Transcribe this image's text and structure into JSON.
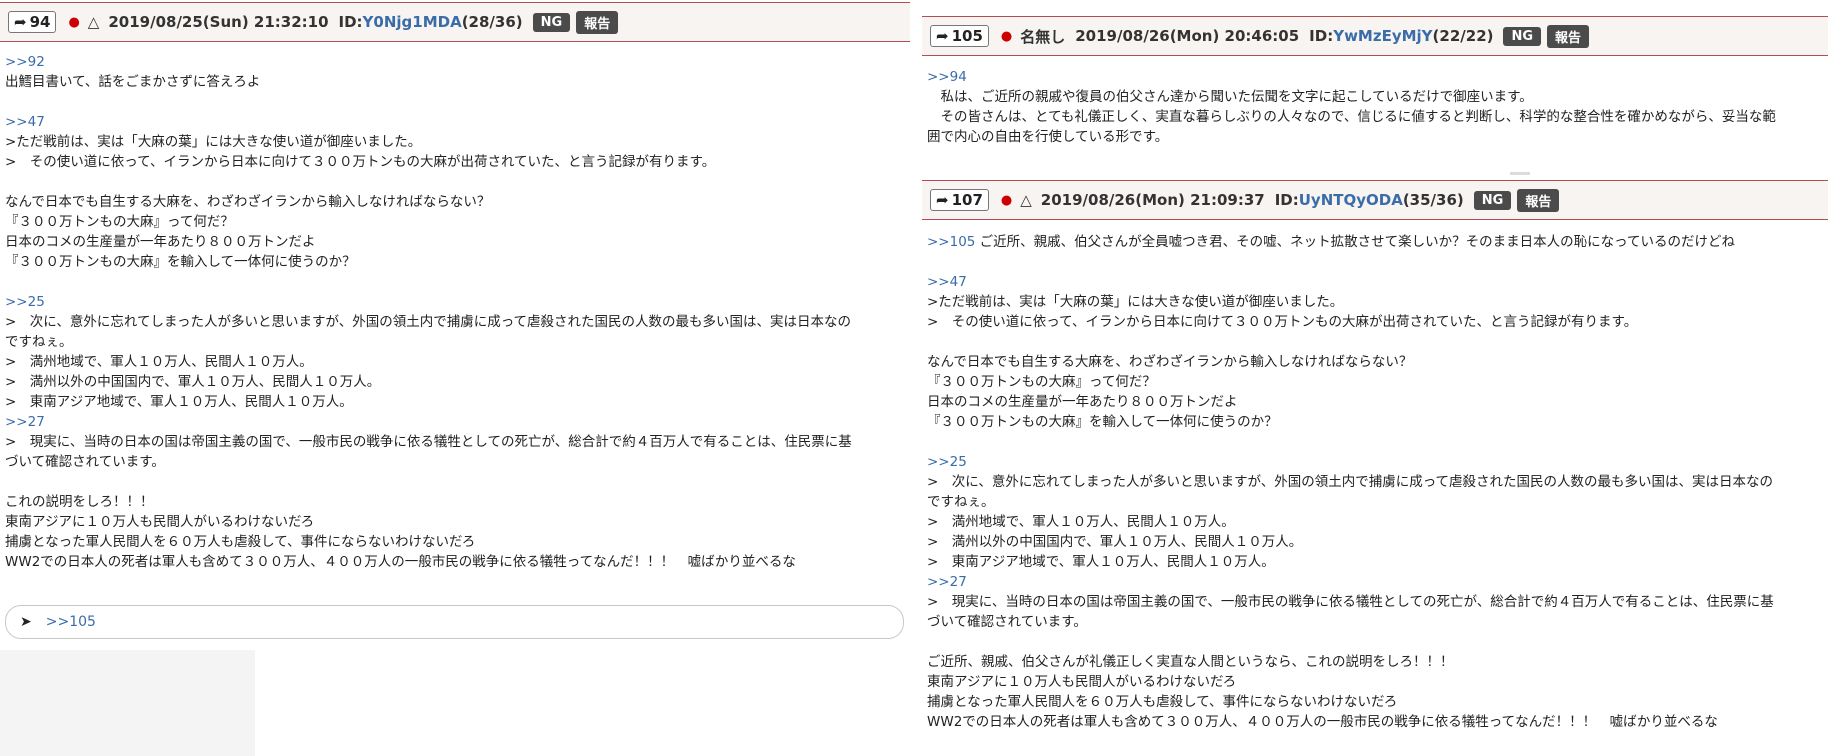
{
  "colors": {
    "link": "#3a6ca8",
    "header_bg": "#f8f4f2",
    "header_border": "#b05050",
    "dot": "#cc0000",
    "badge_bg": "#4b4b4b"
  },
  "icons": {
    "reply_arrow": "arrow-icon",
    "send": "send-icon"
  },
  "posts": {
    "p94": {
      "num": "94",
      "tri": "△",
      "date": "2019/08/25(Sun) 21:32:10",
      "id_label": "ID:",
      "id": "Y0Njg1MDA",
      "count": "(28/36)",
      "ng": "NG",
      "report": "報告",
      "lines": [
        {
          "t": ">>92",
          "k": "link"
        },
        {
          "t": "出鱈目書いて、話をごまかさずに答えろよ",
          "k": "text"
        },
        {
          "t": "",
          "k": "gap"
        },
        {
          "t": ">>47",
          "k": "link"
        },
        {
          "t": ">ただ戦前は、実は「大麻の葉」には大きな使い道が御座いました。",
          "k": "text"
        },
        {
          "t": ">　その使い道に依って、イランから日本に向けて３００万トンもの大麻が出荷されていた、と言う記録が有ります。",
          "k": "text"
        },
        {
          "t": "",
          "k": "gap"
        },
        {
          "t": "なんで日本でも自生する大麻を、わざわざイランから輸入しなければならない？",
          "k": "text"
        },
        {
          "t": "『３００万トンもの大麻』って何だ？",
          "k": "text"
        },
        {
          "t": "日本のコメの生産量が一年あたり８００万トンだよ",
          "k": "text"
        },
        {
          "t": "『３００万トンもの大麻』を輸入して一体何に使うのか？",
          "k": "text"
        },
        {
          "t": "",
          "k": "gap"
        },
        {
          "t": ">>25",
          "k": "link"
        },
        {
          "t": ">　次に、意外に忘れてしまった人が多いと思いますが、外国の領土内で捕虜に成って虐殺された国民の人数の最も多い国は、実は日本なの",
          "k": "text"
        },
        {
          "t": "ですねぇ。",
          "k": "text"
        },
        {
          "t": ">　満州地域で、軍人１０万人、民間人１０万人。",
          "k": "text"
        },
        {
          "t": ">　満州以外の中国国内で、軍人１０万人、民間人１０万人。",
          "k": "text"
        },
        {
          "t": ">　東南アジア地域で、軍人１０万人、民間人１０万人。",
          "k": "text"
        },
        {
          "t": ">>27",
          "k": "link"
        },
        {
          "t": ">　現実に、当時の日本の国は帝国主義の国で、一般市民の戦争に依る犠牲としての死亡が、総合計で約４百万人で有ることは、住民票に基",
          "k": "text"
        },
        {
          "t": "づいて確認されています。",
          "k": "text"
        },
        {
          "t": "",
          "k": "gap"
        },
        {
          "t": "これの説明をしろ！！！",
          "k": "text"
        },
        {
          "t": "東南アジアに１０万人も民間人がいるわけないだろ",
          "k": "text"
        },
        {
          "t": "捕虜となった軍人民間人を６０万人も虐殺して、事件にならないわけないだろ",
          "k": "text"
        },
        {
          "t": "WW2での日本人の死者は軍人も含めて３００万人、４００万人の一般市民の戦争に依る犠牲ってなんだ！！！　嘘ばかり並べるな",
          "k": "text"
        }
      ]
    },
    "p105": {
      "num": "105",
      "name": "名無し",
      "date": "2019/08/26(Mon) 20:46:05",
      "id_label": "ID:",
      "id": "YwMzEyMjY",
      "count": "(22/22)",
      "ng": "NG",
      "report": "報告",
      "lines": [
        {
          "t": ">>94",
          "k": "link"
        },
        {
          "t": "　私は、ご近所の親戚や復員の伯父さん達から聞いた伝聞を文字に起こしているだけで御座います。",
          "k": "text"
        },
        {
          "t": "　その皆さんは、とても礼儀正しく、実直な暮らしぶりの人々なので、信じるに値すると判断し、科学的な整合性を確かめながら、妥当な範",
          "k": "text"
        },
        {
          "t": "囲で内心の自由を行使している形です。",
          "k": "text"
        }
      ]
    },
    "p107": {
      "num": "107",
      "tri": "△",
      "date": "2019/08/26(Mon) 21:09:37",
      "id_label": "ID:",
      "id": "UyNTQyODA",
      "count": "(35/36)",
      "ng": "NG",
      "report": "報告",
      "first_link": ">>105",
      "first_text": " ご近所、親戚、伯父さんが全員嘘つき君、その嘘、ネット拡散させて楽しいか？そのまま日本人の恥になっているのだけどね",
      "lines": [
        {
          "t": "",
          "k": "gap"
        },
        {
          "t": ">>47",
          "k": "link"
        },
        {
          "t": ">ただ戦前は、実は「大麻の葉」には大きな使い道が御座いました。",
          "k": "text"
        },
        {
          "t": ">　その使い道に依って、イランから日本に向けて３００万トンもの大麻が出荷されていた、と言う記録が有ります。",
          "k": "text"
        },
        {
          "t": "",
          "k": "gap"
        },
        {
          "t": "なんで日本でも自生する大麻を、わざわざイランから輸入しなければならない？",
          "k": "text"
        },
        {
          "t": "『３００万トンもの大麻』って何だ？",
          "k": "text"
        },
        {
          "t": "日本のコメの生産量が一年あたり８００万トンだよ",
          "k": "text"
        },
        {
          "t": "『３００万トンもの大麻』を輸入して一体何に使うのか？",
          "k": "text"
        },
        {
          "t": "",
          "k": "gap"
        },
        {
          "t": ">>25",
          "k": "link"
        },
        {
          "t": ">　次に、意外に忘れてしまった人が多いと思いますが、外国の領土内で捕虜に成って虐殺された国民の人数の最も多い国は、実は日本なの",
          "k": "text"
        },
        {
          "t": "ですねぇ。",
          "k": "text"
        },
        {
          "t": ">　満州地域で、軍人１０万人、民間人１０万人。",
          "k": "text"
        },
        {
          "t": ">　満州以外の中国国内で、軍人１０万人、民間人１０万人。",
          "k": "text"
        },
        {
          "t": ">　東南アジア地域で、軍人１０万人、民間人１０万人。",
          "k": "text"
        },
        {
          "t": ">>27",
          "k": "link"
        },
        {
          "t": ">　現実に、当時の日本の国は帝国主義の国で、一般市民の戦争に依る犠牲としての死亡が、総合計で約４百万人で有ることは、住民票に基",
          "k": "text"
        },
        {
          "t": "づいて確認されています。",
          "k": "text"
        },
        {
          "t": "",
          "k": "gap"
        },
        {
          "t": "ご近所、親戚、伯父さんが礼儀正しく実直な人間というなら、これの説明をしろ！！！",
          "k": "text"
        },
        {
          "t": "東南アジアに１０万人も民間人がいるわけないだろ",
          "k": "text"
        },
        {
          "t": "捕虜となった軍人民間人を６０万人も虐殺して、事件にならないわけないだろ",
          "k": "text"
        },
        {
          "t": "WW2での日本人の死者は軍人も含めて３００万人、４００万人の一般市民の戦争に依る犠牲ってなんだ！！！　嘘ばかり並べるな",
          "k": "text"
        }
      ]
    }
  },
  "reply_box": {
    "value": ">>105"
  }
}
